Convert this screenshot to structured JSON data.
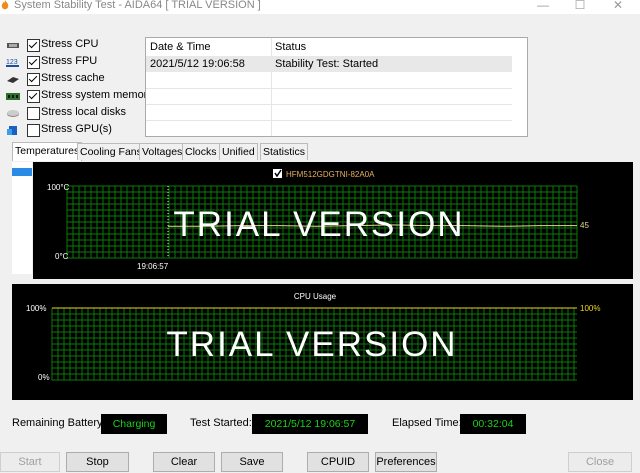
{
  "window": {
    "title": "System Stability Test - AIDA64  [ TRIAL VERSION ]"
  },
  "stress": [
    {
      "label": "Stress CPU",
      "checked": true,
      "icon": "cpu-icon"
    },
    {
      "label": "Stress FPU",
      "checked": true,
      "icon": "fpu-icon"
    },
    {
      "label": "Stress cache",
      "checked": true,
      "icon": "cache-icon"
    },
    {
      "label": "Stress system memory",
      "checked": true,
      "icon": "memory-icon"
    },
    {
      "label": "Stress local disks",
      "checked": false,
      "icon": "disk-icon"
    },
    {
      "label": "Stress GPU(s)",
      "checked": false,
      "icon": "gpu-icon"
    }
  ],
  "log": {
    "headers": {
      "datetime": "Date & Time",
      "status": "Status"
    },
    "rows": [
      {
        "datetime": "2021/5/12 19:06:58",
        "status": "Stability Test: Started"
      }
    ]
  },
  "tabs": [
    "Temperatures",
    "Cooling Fans",
    "Voltages",
    "Clocks",
    "Unified",
    "Statistics"
  ],
  "temp_chart": {
    "legend": "HFM512GDGTNI-82A0A",
    "ymax_label": "100°C",
    "ymin_label": "0°C",
    "time_label": "19:06:57",
    "value_label": "45",
    "watermark": "TRIAL VERSION",
    "line_color": "#e8d890",
    "grid_color": "#0a7a0a"
  },
  "cpu_chart": {
    "title": "CPU Usage",
    "ymax_label": "100%",
    "ymin_label": "0%",
    "value_label": "100%",
    "watermark": "TRIAL VERSION",
    "line_color": "#e8d820"
  },
  "chart_data": [
    {
      "type": "line",
      "series": [
        {
          "name": "HFM512GDGTNI-82A0A",
          "values": [
            44,
            44,
            45,
            45,
            44,
            45,
            46,
            45,
            45,
            44,
            45,
            45
          ]
        }
      ],
      "ylim": [
        0,
        100
      ]
    },
    {
      "type": "line",
      "title": "CPU Usage",
      "series": [
        {
          "values": [
            100,
            100,
            100,
            100,
            100,
            100,
            100,
            100
          ]
        }
      ],
      "ylim": [
        0,
        100
      ]
    }
  ],
  "status": {
    "battery_label": "Remaining Battery:",
    "battery_value": "Charging",
    "started_label": "Test Started:",
    "started_value": "2021/5/12 19:06:57",
    "elapsed_label": "Elapsed Time:",
    "elapsed_value": "00:32:04"
  },
  "buttons": {
    "start": "Start",
    "stop": "Stop",
    "clear": "Clear",
    "save": "Save",
    "cpuid": "CPUID",
    "preferences": "Preferences",
    "close": "Close"
  }
}
